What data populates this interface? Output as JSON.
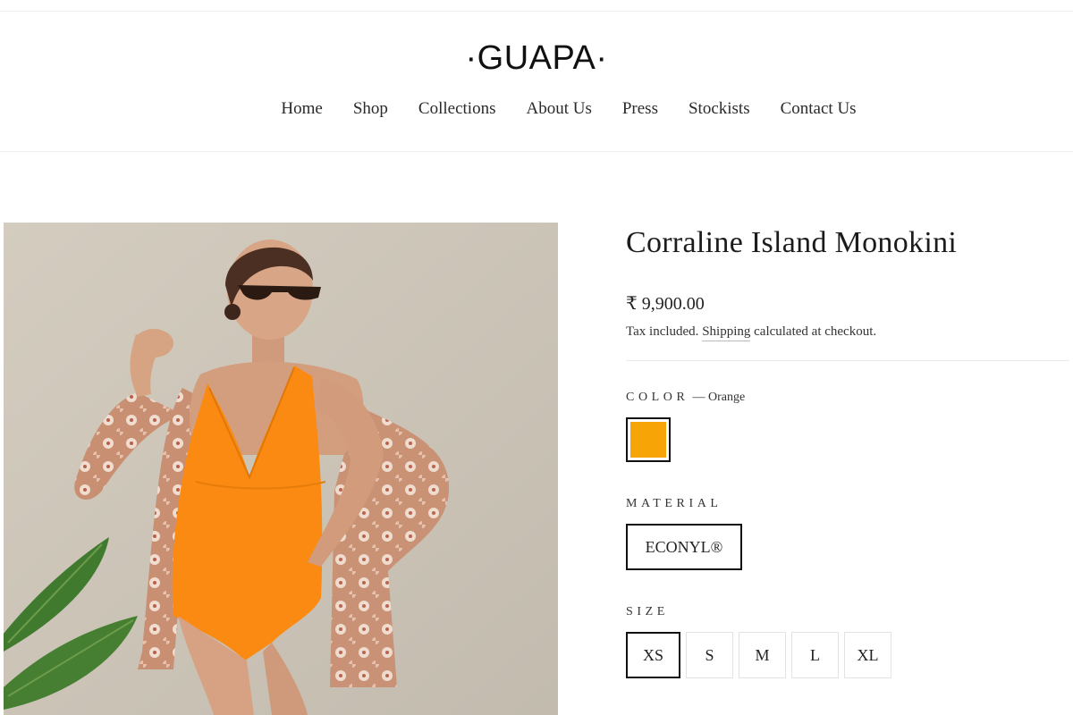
{
  "brand": {
    "logo_text": "·GUAPA·"
  },
  "nav": {
    "items": [
      {
        "label": "Home"
      },
      {
        "label": "Shop"
      },
      {
        "label": "Collections"
      },
      {
        "label": "About Us"
      },
      {
        "label": "Press"
      },
      {
        "label": "Stockists"
      },
      {
        "label": "Contact Us"
      }
    ]
  },
  "product": {
    "title": "Corraline Island Monokini",
    "price": "₹ 9,900.00",
    "tax_prefix": "Tax included.",
    "shipping_link": "Shipping",
    "tax_suffix": "calculated at checkout.",
    "image_icon": "product-photo",
    "color": {
      "label": "COLOR",
      "selected_text": "— Orange",
      "swatch_color": "#f6a406"
    },
    "material": {
      "label": "MATERIAL",
      "options": [
        {
          "label": "ECONYL®"
        }
      ]
    },
    "size": {
      "label": "SIZE",
      "options": [
        {
          "label": "XS"
        },
        {
          "label": "S"
        },
        {
          "label": "M"
        },
        {
          "label": "L"
        },
        {
          "label": "XL"
        }
      ],
      "selected": "XS"
    }
  }
}
